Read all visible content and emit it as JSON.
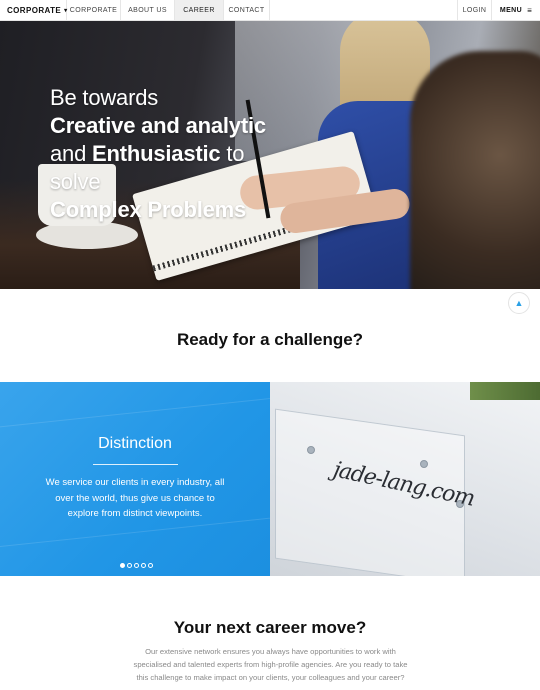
{
  "nav": {
    "brand": "CORPORATE",
    "links": [
      "CORPORATE",
      "ABOUT US",
      "CAREER",
      "CONTACT"
    ],
    "active_index": 2,
    "login": "LOGIN",
    "menu": "MENU"
  },
  "hero": {
    "line1": "Be towards",
    "line2_bold": "Creative and analytic",
    "line3_pre": "and ",
    "line3_bold": "Enthusiastic",
    "line3_post": " to",
    "line4": "solve",
    "line5_bold": "Complex Problems"
  },
  "challenge": {
    "title": "Ready for a challenge?"
  },
  "slider": {
    "title": "Distinction",
    "text": "We service our clients in every industry, all over the world, thus give us chance to explore from distinct viewpoints.",
    "dots": 5,
    "active_dot": 0,
    "scribble": "jade-lang.com"
  },
  "career": {
    "title": "Your next career move?",
    "text": "Our extensive network ensures you always have opportunities to work with specialised and talented experts from high-profile agencies. Are you ready to take this challenge to make impact on your clients, your colleagues and your career?"
  },
  "icons": {
    "brand_dropdown": "chevron-down-icon",
    "menu": "hamburger-icon",
    "scroll_top": "arrow-up-icon"
  },
  "colors": {
    "accent": "#29a0e6",
    "slider_blue": "#2196e6"
  }
}
